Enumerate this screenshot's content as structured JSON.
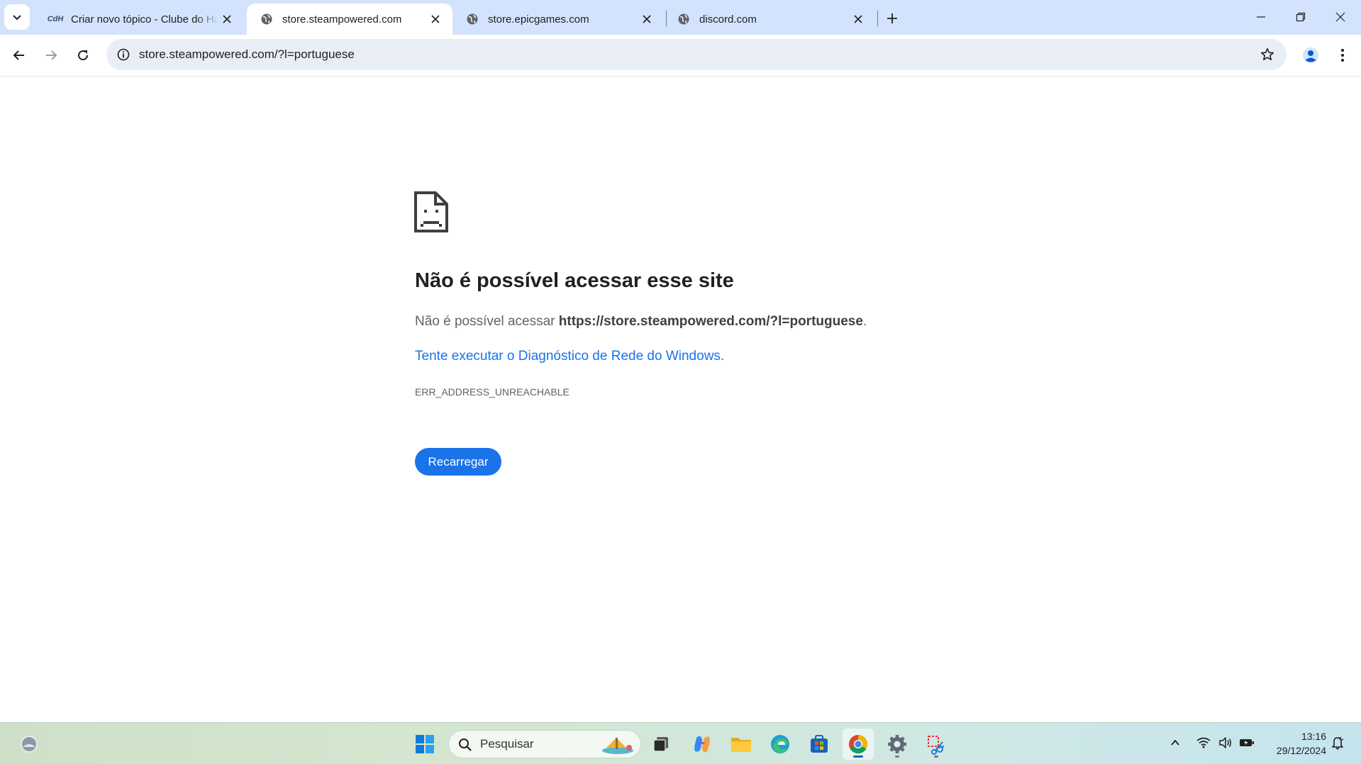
{
  "browser": {
    "tabs": [
      {
        "title": "Criar novo tópico - Clube do Hardware",
        "favicon": "clube-do-hardware-logo",
        "active": false
      },
      {
        "title": "store.steampowered.com",
        "favicon": "globe-icon",
        "active": true
      },
      {
        "title": "store.epicgames.com",
        "favicon": "globe-icon",
        "active": false
      },
      {
        "title": "discord.com",
        "favicon": "globe-icon",
        "active": false
      }
    ],
    "favicon_text_clube": "CdH",
    "address_bar": {
      "url": "store.steampowered.com/?l=portuguese"
    }
  },
  "error_page": {
    "title": "Não é possível acessar esse site",
    "desc_prefix": "Não é possível acessar ",
    "desc_url": "https://store.steampowered.com/?l=portuguese",
    "desc_suffix": ".",
    "suggestion_link": "Tente executar o Diagnóstico de Rede do Windows.",
    "error_code": "ERR_ADDRESS_UNREACHABLE",
    "reload_button": "Recarregar"
  },
  "taskbar": {
    "search_placeholder": "Pesquisar",
    "apps": [
      "start-icon",
      "task-view-icon",
      "copilot-icon",
      "file-explorer-icon",
      "edge-icon",
      "microsoft-store-icon",
      "chrome-icon",
      "settings-icon",
      "snipping-tool-icon"
    ],
    "clock": {
      "time": "13:16",
      "date": "29/12/2024"
    }
  },
  "colors": {
    "accent": "#1a73e8",
    "tabstrip": "#d3e3fd",
    "omnibox": "#e9eef6"
  }
}
